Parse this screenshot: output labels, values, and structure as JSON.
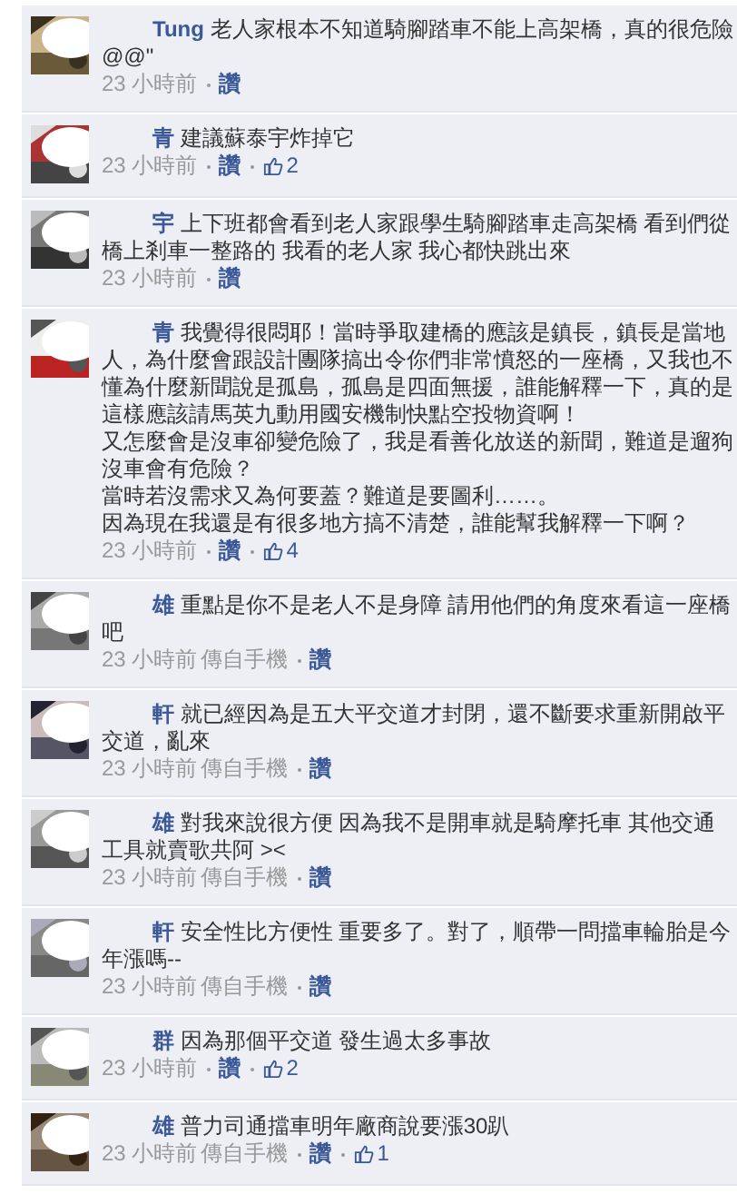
{
  "comments": [
    {
      "author": "Tung",
      "paragraphs": [
        "老人家根本不知道騎腳踏車不能上高架橋，真的很危險@@\""
      ],
      "time": "23 小時前",
      "like_link": "讚"
    },
    {
      "author": "青",
      "paragraphs": [
        "建議蘇泰宇炸掉它"
      ],
      "time": "23 小時前",
      "like_link": "讚",
      "likes": "2"
    },
    {
      "author": "宇",
      "paragraphs": [
        "上下班都會看到老人家跟學生騎腳踏車走高架橋 看到們從橋上剎車一整路的 我看的老人家 我心都快跳出來"
      ],
      "time": "23 小時前",
      "like_link": "讚"
    },
    {
      "author": "青",
      "paragraphs": [
        "我覺得很悶耶！當時爭取建橋的應該是鎮長，鎮長是當地人，為什麼會跟設計團隊搞出令你們非常憤怒的一座橋，又我也不懂為什麼新聞說是孤島，孤島是四面無援，誰能解釋一下，真的是這樣應該請馬英九動用國安機制快點空投物資啊！",
        "又怎麼會是沒車卻變危險了，我是看善化放送的新聞，難道是遛狗沒車會有危險？",
        "當時若沒需求又為何要蓋？難道是要圖利……。",
        "因為現在我還是有很多地方搞不清楚，誰能幫我解釋一下啊？"
      ],
      "time": "23 小時前",
      "like_link": "讚",
      "likes": "4"
    },
    {
      "author": "雄",
      "paragraphs": [
        "重點是你不是老人不是身障 請用他們的角度來看這一座橋吧"
      ],
      "time": "23 小時前",
      "source": "傳自手機",
      "like_link": "讚"
    },
    {
      "author": "軒",
      "paragraphs": [
        "就已經因為是五大平交道才封閉，還不斷要求重新開啟平交道，亂來"
      ],
      "time": "23 小時前",
      "source": "傳自手機",
      "like_link": "讚"
    },
    {
      "author": "雄",
      "paragraphs": [
        "對我來說很方便 因為我不是開車就是騎摩托車 其他交通工具就賣歌共阿 ><"
      ],
      "time": "23 小時前",
      "source": "傳自手機",
      "like_link": "讚"
    },
    {
      "author": "軒",
      "paragraphs": [
        "安全性比方便性 重要多了。對了，順帶一問擋車輪胎是今年漲嗎--"
      ],
      "time": "23 小時前",
      "source": "傳自手機",
      "like_link": "讚"
    },
    {
      "author": "群",
      "paragraphs": [
        "因為那個平交道 發生過太多事故"
      ],
      "time": "23 小時前",
      "like_link": "讚",
      "likes": "2"
    },
    {
      "author": "雄",
      "paragraphs": [
        "普力司通擋車明年廠商說要漲30趴"
      ],
      "time": "23 小時前",
      "source": "傳自手機",
      "like_link": "讚",
      "likes": "1"
    }
  ]
}
